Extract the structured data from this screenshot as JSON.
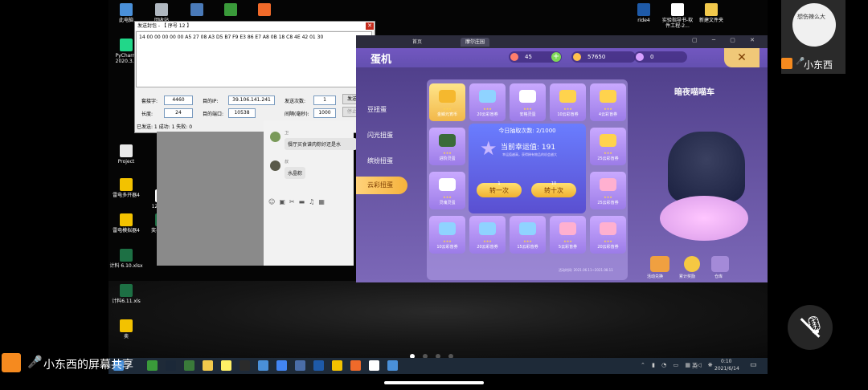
{
  "desktop": {
    "icons_left": [
      {
        "label": "此电脑",
        "color": "#4a90d9"
      },
      {
        "label": "回收站",
        "color": "#b0b8c0"
      },
      {
        "label": "PyCharm 2020.3...",
        "color": "#21d789"
      },
      {
        "label": "Project",
        "color": "#e8e8e8"
      },
      {
        "label": "雷电多开器4",
        "color": "#f3c200"
      },
      {
        "label": "123.png",
        "color": "#ffffff"
      },
      {
        "label": "雷电模拟器4",
        "color": "#f3c200"
      },
      {
        "label": "奖表.xlsx",
        "color": "#1d7044"
      },
      {
        "label": "计料 6.10.xlsx",
        "color": "#1d7044"
      },
      {
        "label": "计料6.11.xls",
        "color": "#1d7044"
      },
      {
        "label": "卖",
        "color": "#f3c200"
      }
    ],
    "icons_top_right": [
      {
        "label": "ride4",
        "color": "#1e5aa8"
      },
      {
        "label": "实验指导书-软件工程-2...",
        "color": "#ffffff"
      },
      {
        "label": "新建文件夹",
        "color": "#f2c94c"
      }
    ]
  },
  "send_dialog": {
    "title": "发送封包 - 【 序号 12 】",
    "hex": "14 00 00 00 00 00 A5 27 08 A3 D5 B7 F9 E3 86 E7 A8 0B 18 C8 4E 42 01 30",
    "socket_label": "套接字:",
    "socket_value": "4460",
    "length_label": "长度:",
    "length_value": "24",
    "ip_label": "目的IP:",
    "ip_value": "39.106.141.241",
    "port_label": "目的端口:",
    "port_value": "10538",
    "send_count_label": "发送次数:",
    "send_count_value": "1",
    "interval_label": "间隔(毫秒):",
    "interval_value": "1000",
    "send_button": "发送 (F)",
    "stop_button": "停止 (T)",
    "status": "已发送: 1   成功: 1   失败: 0"
  },
  "chat": {
    "messages": [
      {
        "name": "卫",
        "text": "餐厅买食谱肉粽好还是水"
      },
      {
        "name": "叔",
        "text": "水晶粽"
      }
    ]
  },
  "game": {
    "tabs": [
      "首页",
      "摩尔庄园"
    ],
    "title": "蛋机",
    "resources": {
      "gem": "45",
      "coin": "57650",
      "shell": "0"
    },
    "side_tabs": [
      "豆扭蛋",
      "闪光扭蛋",
      "缤纷扭蛋",
      "云彩扭蛋"
    ],
    "items": [
      {
        "name": "金鳞元宵币",
        "color": "#f5b82e"
      },
      {
        "name": "20云彩盲券",
        "color": "#8fd3ff"
      },
      {
        "name": "安格灵蛋",
        "color": "#ffffff"
      },
      {
        "name": "10云彩盲券",
        "color": "#ffd34d"
      },
      {
        "name": "4云彩盲券",
        "color": "#ffd34d"
      },
      {
        "name": "进阶灵蛋",
        "color": "#3a6b3a"
      },
      {
        "name": "25云彩盲券",
        "color": "#ffd34d"
      },
      {
        "name": "灵魂灵蛋",
        "color": "#ffffff"
      },
      {
        "name": "25云彩盲券",
        "color": "#ffb0d0"
      },
      {
        "name": "10云彩盲券",
        "color": "#8fd3ff"
      },
      {
        "name": "20云彩盲券",
        "color": "#8fd3ff"
      },
      {
        "name": "15云彩盲券",
        "color": "#8fd3ff"
      },
      {
        "name": "5云彩盲券",
        "color": "#ffb0d0"
      },
      {
        "name": "20云彩盲券",
        "color": "#ffb0d0"
      }
    ],
    "center": {
      "today_label": "今日抽取次数: 2/1000",
      "luck_label": "当前幸运值: 191",
      "luck_hint": "幸运值越高，获得稀有物品的机会越大",
      "spin_one_cost": "1",
      "spin_one": "转一次",
      "spin_ten_cost": "10",
      "spin_ten": "转十次"
    },
    "prize_title": "暗夜喵喵车",
    "dates": "活动时间: 2021.06.11~2021.08.11",
    "bottom_buttons": [
      "活动兑换",
      "累计奖励",
      "仓库"
    ]
  },
  "taskbar": {
    "time": "0:10",
    "date": "2021/6/14",
    "lang": "英",
    "app_colors": [
      "#3a9a3a",
      "#1b2838",
      "#3a7a3a",
      "#f2c94c",
      "#fff066",
      "#2b2b2b",
      "#4a90d9",
      "#4285f4",
      "#4a6da8",
      "#1e5aa8",
      "#f3c200",
      "#f06a2a",
      "#ffffff",
      "#4a90d9"
    ]
  },
  "overlays": {
    "share_label": "小东西的屏幕共享",
    "avatar_name": "小东西",
    "avatar_text": "想伤辣么大"
  }
}
